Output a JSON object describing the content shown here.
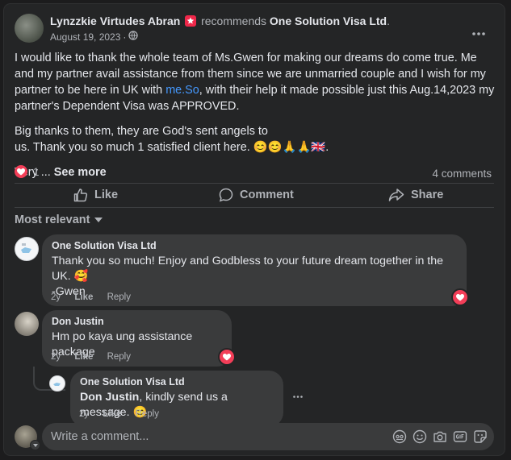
{
  "post": {
    "author": "Lynzzkie Virtudes Abran",
    "verb": "recommends",
    "page": "One Solution Visa Ltd",
    "period": ".",
    "date": "August 19, 2023",
    "separator": "·",
    "p1_a": "I would like to thank the whole team of Ms.Gwen for making our dreams do come true. Me and my partner avail assistance from them since we are unmarried couple and I wish for my partner to be here in UK with ",
    "p1_link": "me.So",
    "p1_b": ", with their help it made possible just this Aug.14,2023 my partner's Dependent Visa was APPROVED.",
    "p2_line1": "Big thanks to them, they are God's sent angels to",
    "p2_line2": "us. Thank you so much 1 satisfied client here. 😊😊🙏🙏🇬🇧.",
    "p3": "Very ...",
    "see_more": "See more",
    "reaction_count": "1",
    "comments_count": "4 comments"
  },
  "actions": {
    "like": "Like",
    "comment": "Comment",
    "share": "Share"
  },
  "filter": {
    "label": "Most relevant"
  },
  "comments": [
    {
      "name": "One Solution Visa Ltd",
      "text": "Thank you so much! Enjoy and Godbless to your future dream together in the UK. 🥰",
      "text2": "-Gwen",
      "time": "2y",
      "like": "Like",
      "reply": "Reply"
    },
    {
      "name": "Don Justin",
      "text": "Hm po kaya ung assistance package",
      "time": "2y",
      "like": "Like",
      "reply": "Reply"
    },
    {
      "name": "One Solution Visa Ltd",
      "mention": "Don Justin",
      "text": ", kindly send us a message. 😊",
      "time": "2y",
      "like": "Like",
      "reply": "Reply"
    }
  ],
  "composer": {
    "placeholder": "Write a comment..."
  },
  "colors": {
    "card": "#242526",
    "bubble": "#3a3b3c",
    "accent": "#4599ff",
    "love": "#f33e58"
  }
}
